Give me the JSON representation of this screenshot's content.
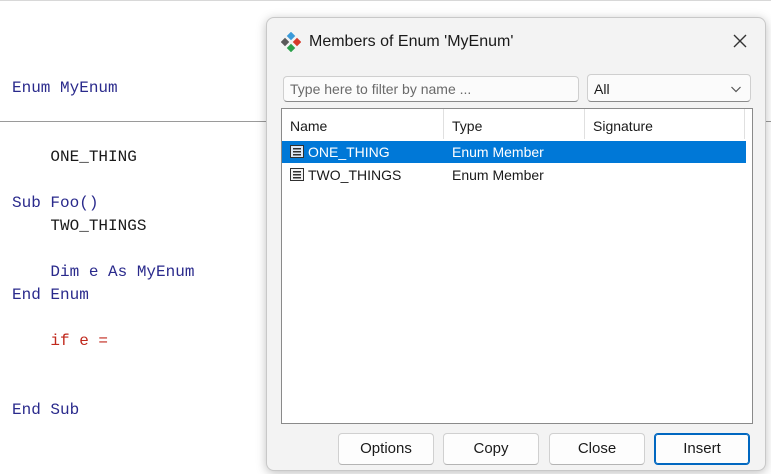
{
  "editor": {
    "enum_block": [
      "Enum MyEnum",
      "    ONE_THING",
      "    TWO_THINGS",
      "End Enum"
    ],
    "sub_block": {
      "line1": "Sub Foo()",
      "line2": "    Dim e As MyEnum",
      "line3": "    if e =",
      "line4": "End Sub"
    }
  },
  "dialog": {
    "title": "Members of Enum 'MyEnum'",
    "filter": {
      "placeholder": "Type here to filter by name ...",
      "value": ""
    },
    "select": {
      "value": "All"
    },
    "columns": [
      "Name",
      "Type",
      "Signature"
    ],
    "rows": [
      {
        "name": "ONE_THING",
        "type": "Enum Member",
        "signature": "",
        "selected": true
      },
      {
        "name": "TWO_THINGS",
        "type": "Enum Member",
        "signature": "",
        "selected": false
      }
    ],
    "buttons": {
      "options": "Options",
      "copy": "Copy",
      "close": "Close",
      "insert": "Insert"
    }
  },
  "colors": {
    "selection": "#0078d7",
    "keyword": "#2a2a8c",
    "error": "#c0281c"
  },
  "icons": {
    "title": "enum-members-icon",
    "close": "close-icon",
    "select": "chevron-down-icon",
    "member": "enum-member-icon"
  }
}
